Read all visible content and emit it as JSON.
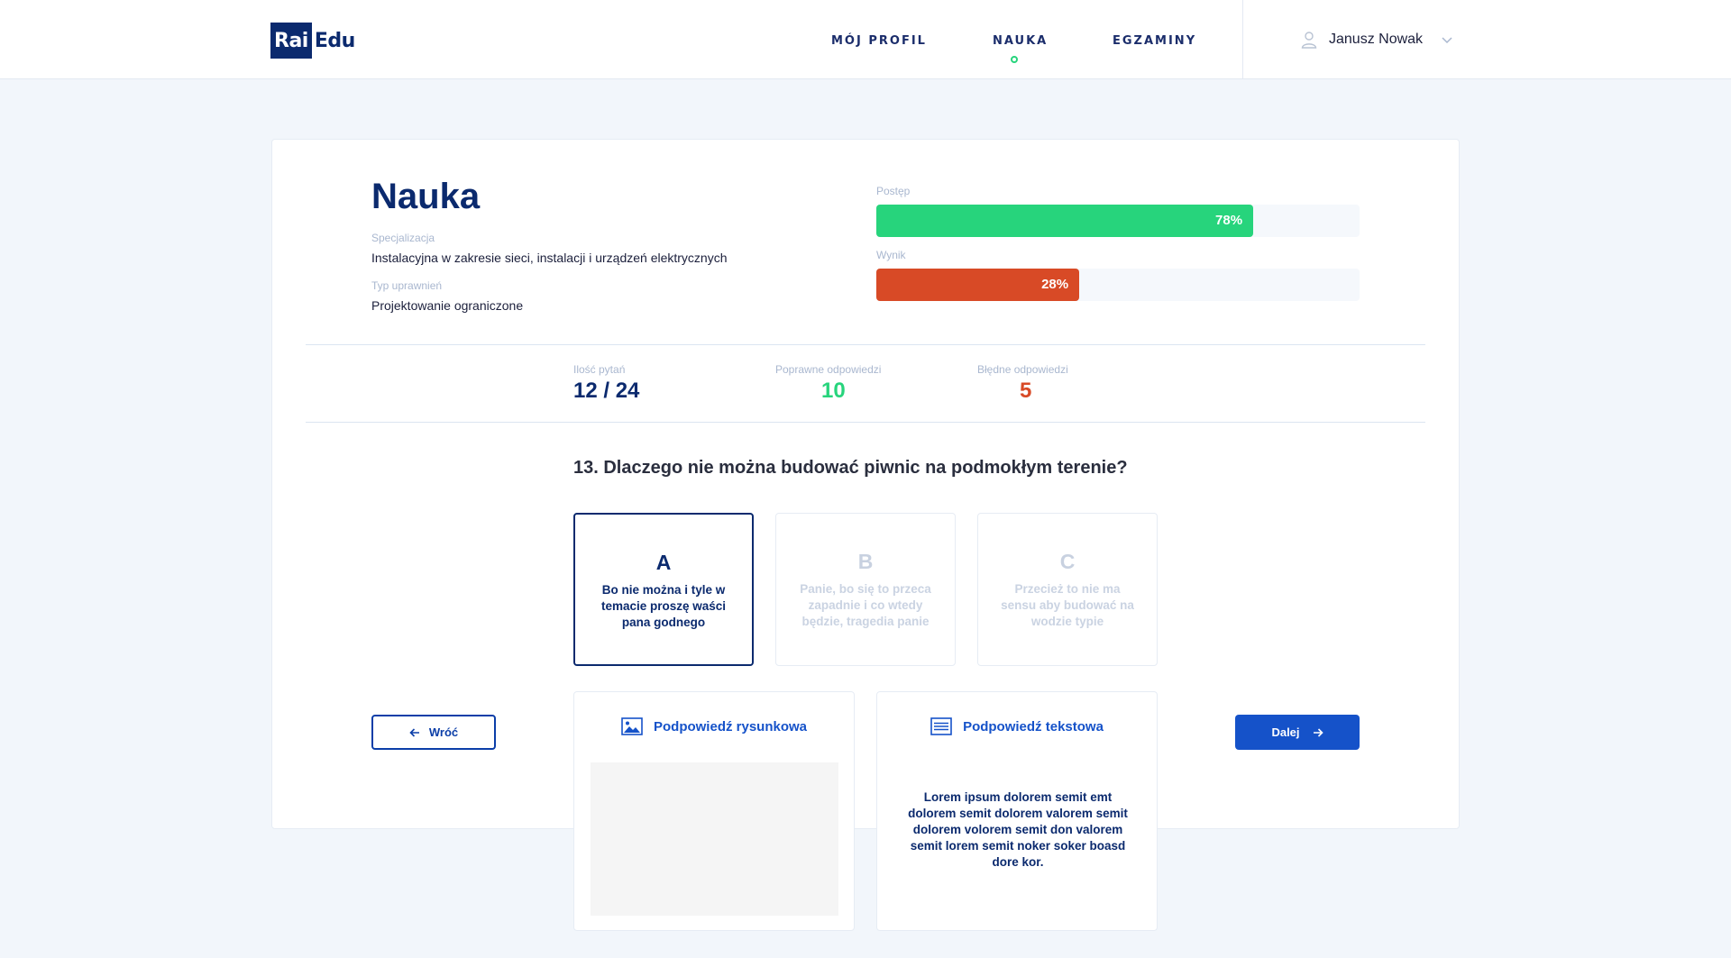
{
  "header": {
    "logo_rai": "Rai",
    "logo_edu": "Edu",
    "nav": [
      {
        "label": "MÓJ PROFIL",
        "active": false
      },
      {
        "label": "NAUKA",
        "active": true
      },
      {
        "label": "EGZAMINY",
        "active": false
      }
    ],
    "user_name": "Janusz Nowak",
    "user_icon": "user-icon",
    "active_dot_color": "#27d47c"
  },
  "main": {
    "title": "Nauka",
    "specialization_label": "Specjalizacja",
    "specialization_value": "Instalacyjna w zakresie sieci, instalacji i urządzeń elektrycznych",
    "permission_label": "Typ uprawnień",
    "permission_value": "Projektowanie ograniczone",
    "progress": {
      "label": "Postęp",
      "value_text": "78%",
      "percent": 78,
      "color": "#27d47c"
    },
    "score": {
      "label": "Wynik",
      "value_text": "28%",
      "percent": 28,
      "color": "#d84a26"
    }
  },
  "stats": [
    {
      "label": "Ilość pytań",
      "value": "12 / 24",
      "color": "#0b2a6e"
    },
    {
      "label": "Poprawne odpowiedzi",
      "value": "10",
      "color": "#27d47c"
    },
    {
      "label": "Błędne odpowiedzi",
      "value": "5",
      "color": "#d84a26"
    }
  ],
  "question": {
    "text": "13. Dlaczego nie można budować piwnic na podmokłym terenie?",
    "options": [
      {
        "letter": "A",
        "text": "Bo nie można i tyle w temacie proszę waści pana godnego",
        "selected": true
      },
      {
        "letter": "B",
        "text": "Panie, bo się to przeca zapadnie i co wtedy będzie, tragedia panie",
        "selected": false
      },
      {
        "letter": "C",
        "text": "Przecież to nie ma sensu aby budować na wodzie typie",
        "selected": false
      }
    ]
  },
  "buttons": {
    "back": "Wróć",
    "next": "Dalej"
  },
  "hints": {
    "image_title": "Podpowiedź rysunkowa",
    "image_icon": "image-icon",
    "text_title": "Podpowiedź tekstowa",
    "text_icon": "text-lines-icon",
    "text_body": "Lorem ipsum dolorem semit emt dolorem semit dolorem valorem semit dolorem volorem semit don valorem semit lorem semit noker soker boasd dore kor."
  }
}
